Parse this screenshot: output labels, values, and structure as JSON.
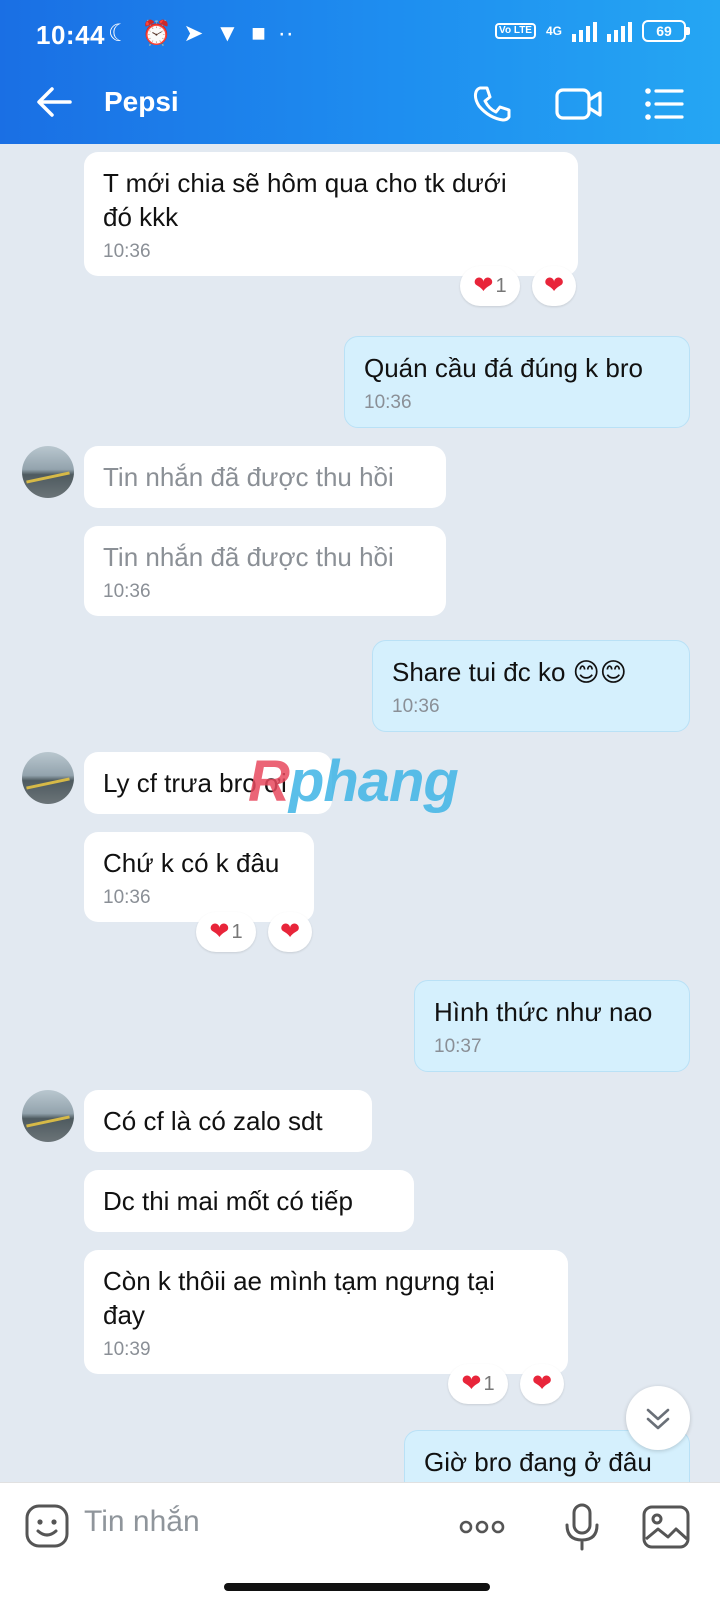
{
  "status": {
    "time": "10:44",
    "network": "4G",
    "volte": "Vo LTE",
    "battery": "69"
  },
  "header": {
    "contact_name": "Pepsi"
  },
  "messages": [
    {
      "text": "T mới chia sẽ hôm qua cho tk dưới\nđó kkk",
      "time": "10:36",
      "reaction_count": "1"
    },
    {
      "text": "Quán cầu đá đúng k bro",
      "time": "10:36"
    },
    {
      "text": "Tin nhắn đã được thu hồi"
    },
    {
      "text": "Tin nhắn đã được thu hồi",
      "time": "10:36"
    },
    {
      "text": "Share tui đc ko 😊😊",
      "time": "10:36"
    },
    {
      "text": "Ly cf trưa bro ơi"
    },
    {
      "text": "Chứ k có k đâu",
      "time": "10:36",
      "reaction_count": "1"
    },
    {
      "text": "Hình thức như nao",
      "time": "10:37"
    },
    {
      "text": "Có cf là có zalo sdt"
    },
    {
      "text": "Dc thi mai mốt có tiếp"
    },
    {
      "text": "Còn k thôii ae mình tạm ngưng tại\nđay",
      "time": "10:39",
      "reaction_count": "1"
    },
    {
      "text": "Giờ bro đang ở đâu"
    }
  ],
  "watermark": {
    "part1": "R",
    "part2": "phang"
  },
  "composer": {
    "placeholder": "Tin nhắn"
  },
  "colors": {
    "header_start": "#1a6fe4",
    "header_end": "#25a6f3",
    "sent_bubble": "#d5f0fd",
    "received_bubble": "#ffffff",
    "chat_bg": "#e2e9f1",
    "heart": "#e8253a"
  }
}
